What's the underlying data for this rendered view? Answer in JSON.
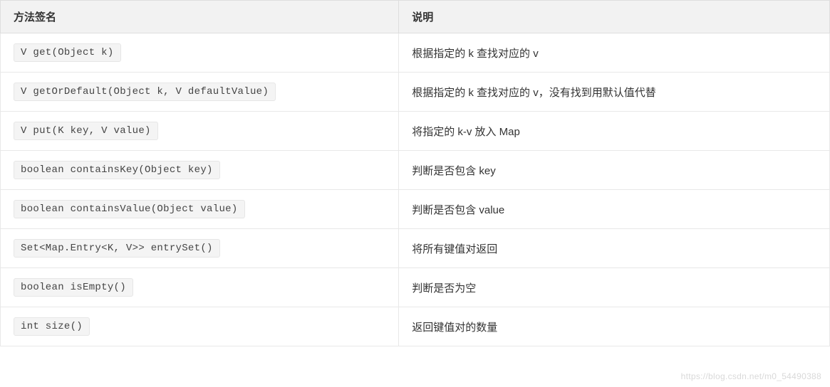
{
  "table": {
    "headers": {
      "signature": "方法签名",
      "description": "说明"
    },
    "rows": [
      {
        "signature": "V get(Object k)",
        "description": "根据指定的 k 查找对应的 v"
      },
      {
        "signature": "V getOrDefault(Object k, V defaultValue)",
        "description": "根据指定的 k 查找对应的 v，没有找到用默认值代替"
      },
      {
        "signature": "V put(K key, V value)",
        "description": "将指定的 k-v 放入 Map"
      },
      {
        "signature": "boolean containsKey(Object key)",
        "description": "判断是否包含 key"
      },
      {
        "signature": "boolean containsValue(Object value)",
        "description": "判断是否包含 value"
      },
      {
        "signature": "Set<Map.Entry<K, V>> entrySet()",
        "description": "将所有键值对返回"
      },
      {
        "signature": "boolean isEmpty()",
        "description": "判断是否为空"
      },
      {
        "signature": "int size()",
        "description": "返回键值对的数量"
      }
    ]
  },
  "watermark": "https://blog.csdn.net/m0_54490388"
}
